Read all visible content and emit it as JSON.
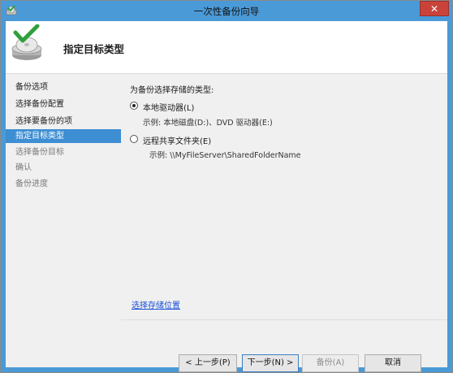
{
  "window": {
    "title": "一次性备份向导",
    "close_glyph": "✕"
  },
  "header": {
    "title": "指定目标类型"
  },
  "nav": {
    "items": [
      {
        "label": "备份选项",
        "state": "normal"
      },
      {
        "label": "选择备份配置",
        "state": "normal"
      },
      {
        "label": "选择要备份的项",
        "state": "normal"
      },
      {
        "label": "指定目标类型",
        "state": "selected"
      },
      {
        "label": "选择备份目标",
        "state": "disabled"
      },
      {
        "label": "确认",
        "state": "disabled"
      },
      {
        "label": "备份进度",
        "state": "disabled"
      }
    ]
  },
  "content": {
    "prompt": "为备份选择存储的类型:",
    "options": [
      {
        "label": "本地驱动器(L)",
        "example": "示例: 本地磁盘(D:)、DVD 驱动器(E:)",
        "selected": true
      },
      {
        "label": "远程共享文件夹(E)",
        "example": "示例: \\\\MyFileServer\\SharedFolderName",
        "selected": false
      }
    ],
    "link": "选择存储位置"
  },
  "buttons": {
    "back": "< 上一步(P)",
    "next": "下一步(N) >",
    "backup": "备份(A)",
    "cancel": "取消"
  },
  "icons": {
    "app": "backup-app-icon",
    "header": "backup-drive-icon",
    "close": "close-icon"
  },
  "colors": {
    "titlebar": "#4b9ad8",
    "close_button": "#c9433a",
    "selection": "#3d8ed3",
    "link": "#1a4fd8"
  }
}
